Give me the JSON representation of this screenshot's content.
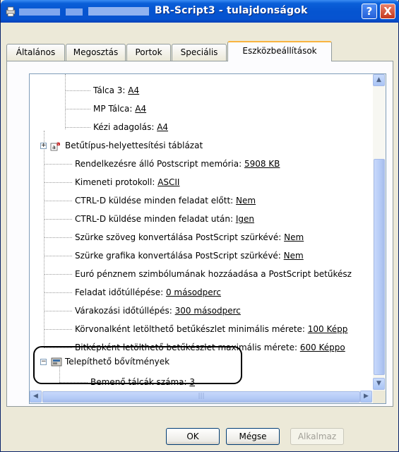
{
  "window": {
    "title": "BR-Script3 - tulajdonságok",
    "help_label": "?",
    "close_label": "X"
  },
  "tabs": [
    {
      "label": "Általános"
    },
    {
      "label": "Megosztás"
    },
    {
      "label": "Portok"
    },
    {
      "label": "Speciális"
    },
    {
      "label": "Eszközbeállítások",
      "active": true
    }
  ],
  "tree": {
    "rows": [
      {
        "label": "Tálca 3: ",
        "value": "A4"
      },
      {
        "label": "MP Tálca: ",
        "value": "A4"
      },
      {
        "label": "Kézi adagolás: ",
        "value": "A4"
      },
      {
        "label": "Betűtípus-helyettesítési táblázat",
        "value": ""
      },
      {
        "label": "Rendelkezésre álló Postscript memória: ",
        "value": "5908 KB"
      },
      {
        "label": "Kimeneti protokoll: ",
        "value": "ASCII"
      },
      {
        "label": "CTRL-D küldése minden feladat előtt: ",
        "value": "Nem"
      },
      {
        "label": "CTRL-D küldése minden feladat után: ",
        "value": "Igen"
      },
      {
        "label": "Szürke szöveg konvertálása PostScript szürkévé: ",
        "value": "Nem"
      },
      {
        "label": "Szürke grafika konvertálása PostScript szürkévé: ",
        "value": "Nem"
      },
      {
        "label": "Euró pénznem szimbólumának hozzáadása a PostScript betűkész",
        "value": ""
      },
      {
        "label": "Feladat időtúllépése: ",
        "value": "0 másodperc"
      },
      {
        "label": "Várakozási időtúllépés: ",
        "value": "300 másodperc"
      },
      {
        "label": "Körvonalként letölthető betűkészlet minimális mérete: ",
        "value": "100 Képp"
      },
      {
        "label": "Bitképként letölthető betűkészlet maximális mérete: ",
        "value": "600 Képpo"
      },
      {
        "label": "Telepíthető bővítmények",
        "value": ""
      },
      {
        "label": "Bemenő tálcák száma: ",
        "value": "3"
      }
    ],
    "expander_plus": "+",
    "expander_minus": "−"
  },
  "scroll": {
    "up": "▲",
    "down": "▼",
    "left": "◀",
    "right": "▶",
    "grip": "|||"
  },
  "buttons": {
    "ok": "OK",
    "cancel": "Mégse",
    "apply": "Alkalmaz"
  },
  "colors": {
    "titlebar": "#0554d0",
    "active_tab_accent": "#f8b440"
  }
}
